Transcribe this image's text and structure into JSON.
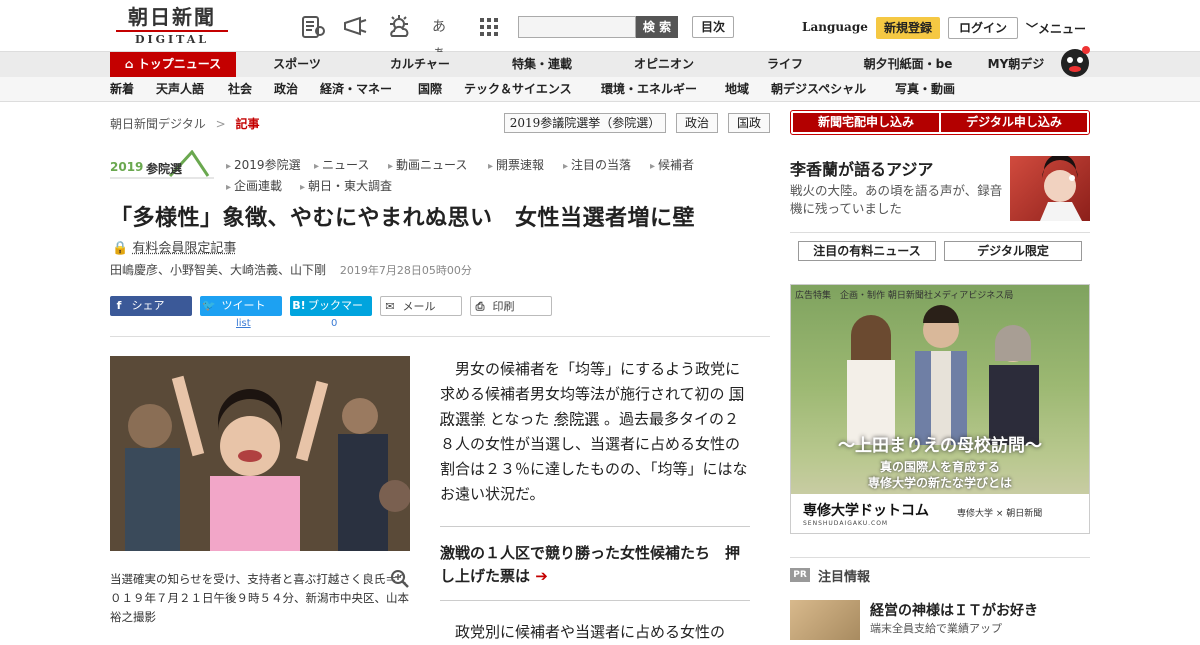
{
  "header": {
    "logo_jp": "朝日新聞",
    "logo_en": "DIGITAL",
    "icons": [
      "newspaper-icon",
      "megaphone-icon",
      "weather-icon",
      "font-size-icon",
      "grid-icon"
    ],
    "font_size_label": "あぁ",
    "search_button": "検 索",
    "mokuji": "目次",
    "language": "Language",
    "signup": "新規登録",
    "login": "ログイン",
    "menu": "メニュー"
  },
  "nav_main": [
    "トップニュース",
    "スポーツ",
    "カルチャー",
    "特集・連載",
    "オピニオン",
    "ライフ",
    "朝夕刊紙面・be",
    "MY朝デジ"
  ],
  "nav_sub": [
    "新着",
    "天声人語",
    "社会",
    "政治",
    "経済・マネー",
    "国際",
    "テック＆サイエンス",
    "環境・エネルギー",
    "地域",
    "朝デジスペシャル",
    "写真・動画"
  ],
  "breadcrumb": {
    "home": "朝日新聞デジタル",
    "sep": ">",
    "current": "記事"
  },
  "tags": [
    "2019参議院選挙（参院選）",
    "政治",
    "国政"
  ],
  "election": {
    "logo_year": "2019",
    "logo_text": "参院選",
    "links_row1": [
      "2019参院選",
      "ニュース",
      "動画ニュース",
      "開票速報",
      "注目の当落",
      "候補者"
    ],
    "links_row2": [
      "企画連載",
      "朝日・東大調査"
    ]
  },
  "article": {
    "title": "「多様性」象徴、やむにやまれぬ思い　女性当選者増に壁",
    "paid_label": "有料会員限定記事",
    "authors": "田嶋慶彦、小野智美、大崎浩義、山下剛",
    "date": "2019年7月28日05時00分",
    "share": {
      "facebook": "シェア",
      "twitter": "ツイート",
      "hatena": "ブックマーク",
      "hatena_icon": "B!",
      "mail": "メール",
      "print": "印刷",
      "twitter_count": "list",
      "hatena_count": "0"
    },
    "caption": "当選確実の知らせを受け、支持者と喜ぶ打越さく良氏＝２０１９年７月２１日午後９時５４分、新潟市中央区、山本裕之撮影",
    "body_p1_a": "男女の候補者を「均等」にするよう政党に求める候補者男女均等法が施行されて初の",
    "body_link1": "国政選挙",
    "body_p1_b": "となった",
    "body_link2": "参院選",
    "body_p1_c": "。過去最多タイの２８人の女性が当選し、当選者に占める女性の割合は２３％に達したものの、「均等」にはなお遠い状況だ。",
    "related": "激戦の１人区で競り勝った女性候補たち　押し上げた票は",
    "body_p2": "政党別に候補者や当選者に占める女性の"
  },
  "sidebar": {
    "subscribe_paper": "新聞宅配申し込み",
    "subscribe_digital": "デジタル申し込み",
    "feature_title": "李香蘭が語るアジア",
    "feature_desc": "戦火の大陸。あの頃を語る声が、録音機に残っていました",
    "tab_paid": "注目の有料ニュース",
    "tab_digital": "デジタル限定",
    "ad": {
      "top_label": "広告特集　企画・制作 朝日新聞社メディアビジネス局",
      "headline": "～上田まりえの母校訪問～",
      "sub1": "真の国際人を育成する",
      "sub2": "専修大学の新たな学びとは",
      "univ": "専修大学ドットコム",
      "domain": "SENSHUDAIGAKU.COM",
      "logos": "専修大学 × 朝日新聞"
    },
    "pr_badge": "PR",
    "pr_title": "注目情報",
    "pr_headline": "経営の神様はＩＴがお好き",
    "pr_desc": "端末全員支給で業績アップ"
  },
  "colors": {
    "brand_red": "#c40000",
    "signup_yellow": "#f5c843",
    "facebook": "#3b5998",
    "twitter": "#1da1f2",
    "hatena": "#00a4de"
  }
}
